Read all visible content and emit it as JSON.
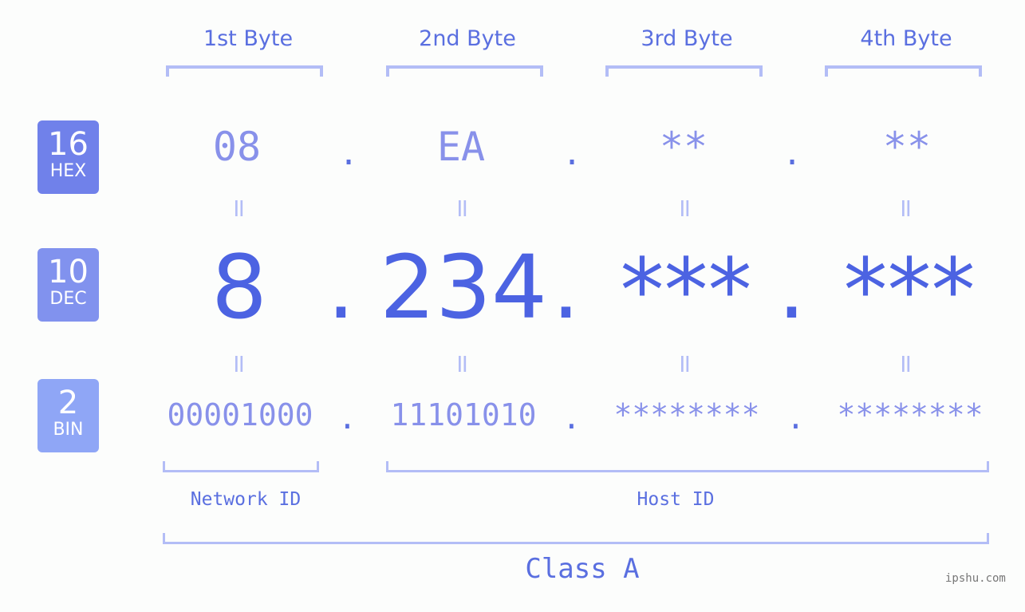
{
  "headers": [
    "1st Byte",
    "2nd Byte",
    "3rd Byte",
    "4th Byte"
  ],
  "badges": [
    {
      "num": "16",
      "label": "HEX",
      "color": "#7081ea"
    },
    {
      "num": "10",
      "label": "DEC",
      "color": "#8192ee"
    },
    {
      "num": "2",
      "label": "BIN",
      "color": "#8fa6f6"
    }
  ],
  "hex": [
    "08",
    "EA",
    "**",
    "**"
  ],
  "dec": [
    "8",
    "234",
    "***",
    "***"
  ],
  "bin": [
    "00001000",
    "11101010",
    "********",
    "********"
  ],
  "separator": ".",
  "equals": "=",
  "network_id_label": "Network ID",
  "host_id_label": "Host ID",
  "class_label": "Class A",
  "watermark": "ipshu.com",
  "colors": {
    "accent": "#4c63e2",
    "light": "#b3bdf6",
    "mid": "#8891ea"
  }
}
